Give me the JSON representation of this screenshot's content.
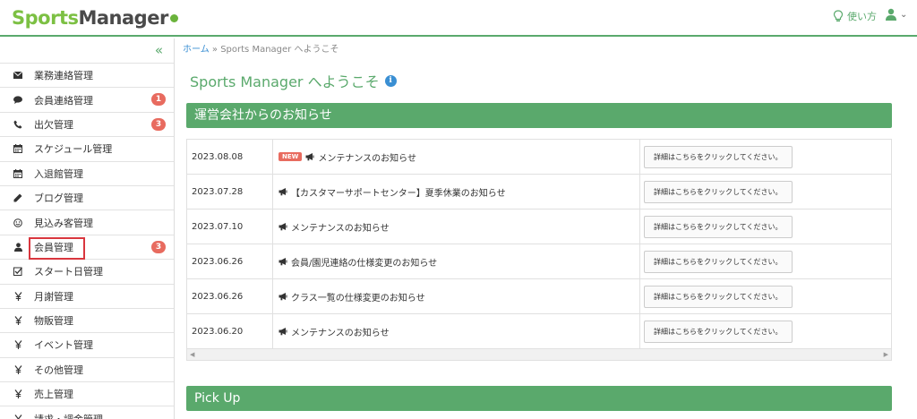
{
  "header": {
    "logo_sports": "Sports",
    "logo_manager": "Manager",
    "help_label": "使い方",
    "user_caret": "⌄"
  },
  "sidebar": {
    "collapse_label": "«",
    "items": [
      {
        "label": "業務連絡管理",
        "icon": "envelope-icon",
        "badge": ""
      },
      {
        "label": "会員連絡管理",
        "icon": "speech-bubble-icon",
        "badge": "1"
      },
      {
        "label": "出欠管理",
        "icon": "phone-icon",
        "badge": "3"
      },
      {
        "label": "スケジュール管理",
        "icon": "calendar-icon",
        "badge": ""
      },
      {
        "label": "入退館管理",
        "icon": "calendar-icon",
        "badge": ""
      },
      {
        "label": "ブログ管理",
        "icon": "pencil-icon",
        "badge": ""
      },
      {
        "label": "見込み客管理",
        "icon": "smiley-icon",
        "badge": ""
      },
      {
        "label": "会員管理",
        "icon": "user-icon",
        "badge": "3"
      },
      {
        "label": "スタート日管理",
        "icon": "check-square-icon",
        "badge": ""
      },
      {
        "label": "月謝管理",
        "icon": "yen-icon",
        "badge": ""
      },
      {
        "label": "物販管理",
        "icon": "yen-icon",
        "badge": ""
      },
      {
        "label": "イベント管理",
        "icon": "yen-icon",
        "badge": ""
      },
      {
        "label": "その他管理",
        "icon": "yen-icon",
        "badge": ""
      },
      {
        "label": "売上管理",
        "icon": "yen-icon",
        "badge": ""
      },
      {
        "label": "請求・調金管理",
        "icon": "yen-icon",
        "badge": ""
      }
    ]
  },
  "breadcrumb": {
    "home": "ホーム",
    "sep": "»",
    "current": "Sports Manager へようこそ"
  },
  "page": {
    "title": "Sports Manager へようこそ",
    "info_glyph": "i"
  },
  "news": {
    "heading": "運営会社からのお知らせ",
    "new_badge": "NEW",
    "detail_label": "詳細はこちらをクリックしてください。",
    "rows": [
      {
        "date": "2023.08.08",
        "subject": "メンテナンスのお知らせ",
        "is_new": true
      },
      {
        "date": "2023.07.28",
        "subject": "【カスタマーサポートセンター】夏季休業のお知らせ",
        "is_new": false
      },
      {
        "date": "2023.07.10",
        "subject": "メンテナンスのお知らせ",
        "is_new": false
      },
      {
        "date": "2023.06.26",
        "subject": "会員/園児連絡の仕様変更のお知らせ",
        "is_new": false
      },
      {
        "date": "2023.06.26",
        "subject": "クラス一覧の仕様変更のお知らせ",
        "is_new": false
      },
      {
        "date": "2023.06.20",
        "subject": "メンテナンスのお知らせ",
        "is_new": false
      }
    ]
  },
  "pickup": {
    "heading": "Pick Up"
  },
  "colors": {
    "brand_green": "#5aa96c",
    "badge_red": "#e86b5f",
    "highlight_red": "#d9363e",
    "link_blue": "#3a8fd3"
  }
}
